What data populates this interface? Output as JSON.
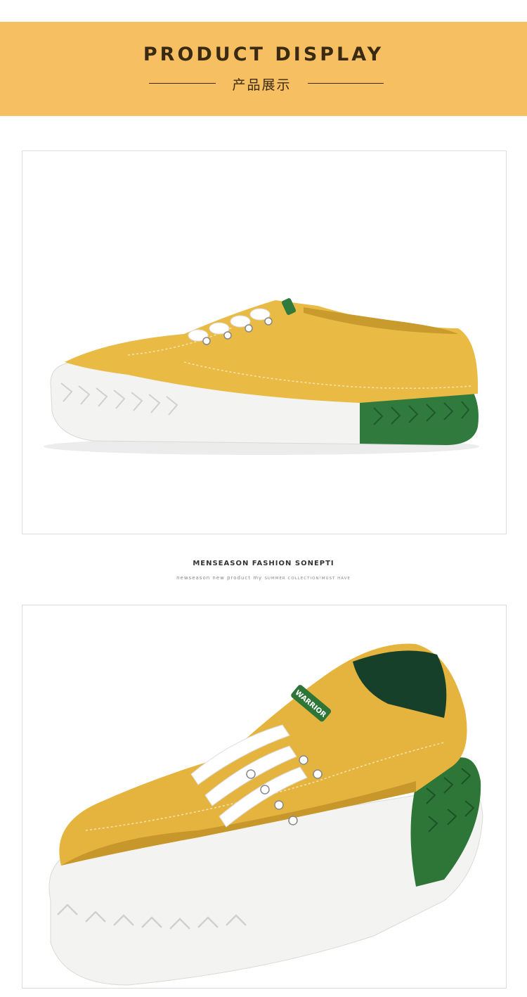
{
  "banner": {
    "title": "PRODUCT DISPLAY",
    "subtitle": "产品展示",
    "background_color": "#f5bf62",
    "text_color": "#3b2a12"
  },
  "divider": {
    "title": "MENSEASON FASHION SONEPTI",
    "subtitle_main": "newseason new product my",
    "subtitle_small": "SUMMER COLLECTION!MUST HAVE"
  },
  "products": [
    {
      "image": "yellow canvas sneaker with green heel, side view",
      "colors": {
        "upper": "#e9bb45",
        "sole": "#f4f4f2",
        "heel": "#2f7a3c",
        "lace": "#ffffff"
      }
    },
    {
      "image": "yellow canvas sneaker with green heel, angled view",
      "tag_text": "WARRIOR",
      "colors": {
        "upper": "#e5b43e",
        "sole": "#f4f4f2",
        "heel": "#2d7638",
        "lace": "#ffffff"
      }
    }
  ]
}
